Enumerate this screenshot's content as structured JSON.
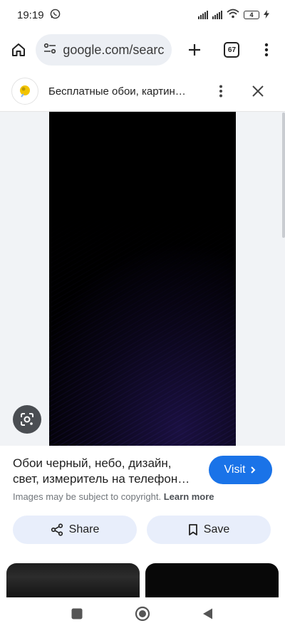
{
  "status_bar": {
    "time": "19:19",
    "battery": "4"
  },
  "browser": {
    "url": "google.com/search",
    "tab_count": "67"
  },
  "site": {
    "title": "Бесплатные обои, картин…"
  },
  "image_info": {
    "caption": "Обои черный, небо, дизайн, свет, измеритель на телефон…",
    "visit_label": "Visit",
    "copyright_text": "Images may be subject to copyright.",
    "learn_more": "Learn more",
    "share_label": "Share",
    "save_label": "Save"
  },
  "colors": {
    "accent": "#1a73e8",
    "pill_bg": "#e8eefb",
    "grey_bg": "#f1f3f6"
  }
}
